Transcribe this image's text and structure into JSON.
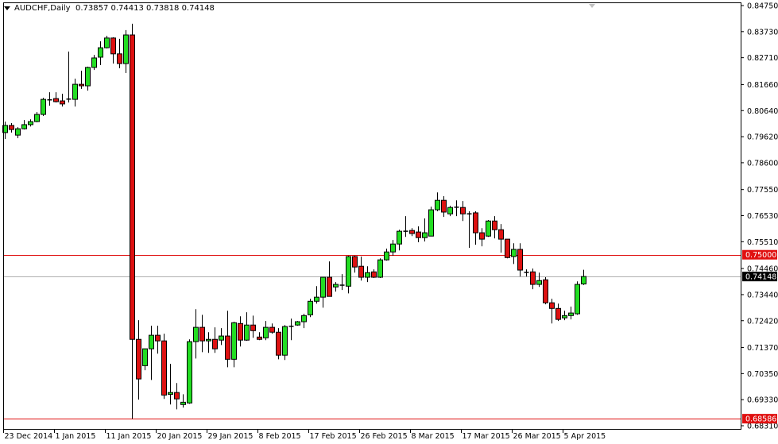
{
  "header": {
    "symbol": "AUDCHF,Daily",
    "ohlc": "0.73857 0.74413 0.73818 0.74148"
  },
  "colors": {
    "bull": "#22dd22",
    "bear": "#dd1111",
    "outline": "#000000",
    "hline": "#e01010",
    "bid_line": "#b0b0b0"
  },
  "chart_data": {
    "type": "candlestick",
    "title": "AUDCHF,Daily",
    "ylim": [
      0.6831,
      0.8475
    ],
    "y_ticks": [
      "0.84750",
      "0.83730",
      "0.82710",
      "0.81660",
      "0.80640",
      "0.79620",
      "0.78600",
      "0.77550",
      "0.76530",
      "0.75510",
      "0.74460",
      "0.73440",
      "0.72420",
      "0.71370",
      "0.70350",
      "0.69330",
      "0.68310"
    ],
    "x_ticks": [
      {
        "index": 0,
        "label": "23 Dec 2014"
      },
      {
        "index": 8,
        "label": "1 Jan 2015"
      },
      {
        "index": 16,
        "label": "11 Jan 2015"
      },
      {
        "index": 24,
        "label": "20 Jan 2015"
      },
      {
        "index": 32,
        "label": "29 Jan 2015"
      },
      {
        "index": 40,
        "label": "8 Feb 2015"
      },
      {
        "index": 48,
        "label": "17 Feb 2015"
      },
      {
        "index": 56,
        "label": "26 Feb 2015"
      },
      {
        "index": 64,
        "label": "8 Mar 2015"
      },
      {
        "index": 72,
        "label": "17 Mar 2015"
      },
      {
        "index": 80,
        "label": "26 Mar 2015"
      },
      {
        "index": 88,
        "label": "5 Apr 2015"
      }
    ],
    "horizontal_lines": [
      {
        "price": 0.75,
        "label": "0.75000",
        "kind": "level"
      },
      {
        "price": 0.68586,
        "label": "0.68586",
        "kind": "level"
      },
      {
        "price": 0.74148,
        "label": "0.74148",
        "kind": "bid"
      }
    ],
    "ohlc": [
      [
        0.7978,
        0.8021,
        0.7953,
        0.8006
      ],
      [
        0.8006,
        0.8015,
        0.7978,
        0.799
      ],
      [
        0.7968,
        0.7999,
        0.7956,
        0.7993
      ],
      [
        0.7993,
        0.8027,
        0.799,
        0.8009
      ],
      [
        0.8009,
        0.803,
        0.8002,
        0.8021
      ],
      [
        0.8021,
        0.8058,
        0.8018,
        0.8049
      ],
      [
        0.8049,
        0.8114,
        0.8043,
        0.8108
      ],
      [
        0.8105,
        0.8136,
        0.8083,
        0.8106
      ],
      [
        0.8111,
        0.8136,
        0.8096,
        0.8099
      ],
      [
        0.8102,
        0.813,
        0.808,
        0.809
      ],
      [
        0.8108,
        0.8295,
        0.8096,
        0.8109
      ],
      [
        0.8108,
        0.8189,
        0.808,
        0.8167
      ],
      [
        0.8167,
        0.822,
        0.8149,
        0.8161
      ],
      [
        0.8161,
        0.8236,
        0.8142,
        0.8233
      ],
      [
        0.8233,
        0.8282,
        0.8223,
        0.827
      ],
      [
        0.8273,
        0.8335,
        0.8242,
        0.831
      ],
      [
        0.831,
        0.8357,
        0.8307,
        0.8348
      ],
      [
        0.8348,
        0.8351,
        0.8248,
        0.8286
      ],
      [
        0.8286,
        0.8345,
        0.823,
        0.8248
      ],
      [
        0.8248,
        0.8379,
        0.8211,
        0.836
      ],
      [
        0.836,
        0.8404,
        0.6858,
        0.7169
      ],
      [
        0.7169,
        0.7244,
        0.6933,
        0.7014
      ],
      [
        0.7066,
        0.7132,
        0.7048,
        0.7132
      ],
      [
        0.7132,
        0.7222,
        0.701,
        0.7185
      ],
      [
        0.7185,
        0.7222,
        0.7113,
        0.7163
      ],
      [
        0.7163,
        0.7191,
        0.6936,
        0.6951
      ],
      [
        0.6954,
        0.7073,
        0.6914,
        0.6961
      ],
      [
        0.6961,
        0.6998,
        0.6895,
        0.6936
      ],
      [
        0.6914,
        0.6954,
        0.6902,
        0.6923
      ],
      [
        0.692,
        0.7169,
        0.6917,
        0.716
      ],
      [
        0.716,
        0.7287,
        0.7094,
        0.7216
      ],
      [
        0.7216,
        0.7265,
        0.7119,
        0.7163
      ],
      [
        0.7163,
        0.7197,
        0.7116,
        0.7169
      ],
      [
        0.7169,
        0.7216,
        0.7116,
        0.7132
      ],
      [
        0.7166,
        0.7213,
        0.7147,
        0.7182
      ],
      [
        0.7182,
        0.7281,
        0.706,
        0.7091
      ],
      [
        0.7091,
        0.7238,
        0.706,
        0.7234
      ],
      [
        0.7231,
        0.7259,
        0.7141,
        0.7166
      ],
      [
        0.7166,
        0.7275,
        0.7163,
        0.7225
      ],
      [
        0.7225,
        0.7262,
        0.7175,
        0.7203
      ],
      [
        0.7178,
        0.7197,
        0.7166,
        0.7169
      ],
      [
        0.7175,
        0.7241,
        0.7166,
        0.7216
      ],
      [
        0.7216,
        0.7231,
        0.7191,
        0.7197
      ],
      [
        0.7197,
        0.7213,
        0.7091,
        0.7107
      ],
      [
        0.7107,
        0.7225,
        0.7088,
        0.7219
      ],
      [
        0.7219,
        0.725,
        0.7166,
        0.722
      ],
      [
        0.7225,
        0.7241,
        0.7222,
        0.7238
      ],
      [
        0.7238,
        0.7269,
        0.7213,
        0.7262
      ],
      [
        0.7265,
        0.7328,
        0.7256,
        0.7318
      ],
      [
        0.7318,
        0.7377,
        0.7309,
        0.7334
      ],
      [
        0.7334,
        0.7412,
        0.7293,
        0.7412
      ],
      [
        0.7412,
        0.7474,
        0.7337,
        0.7337
      ],
      [
        0.7374,
        0.7393,
        0.7356,
        0.7384
      ],
      [
        0.7381,
        0.7424,
        0.7362,
        0.7377
      ],
      [
        0.7377,
        0.7496,
        0.7349,
        0.7493
      ],
      [
        0.7493,
        0.7496,
        0.743,
        0.7452
      ],
      [
        0.7455,
        0.7493,
        0.7399,
        0.7412
      ],
      [
        0.7412,
        0.7455,
        0.7393,
        0.743
      ],
      [
        0.7433,
        0.7443,
        0.7409,
        0.7412
      ],
      [
        0.7412,
        0.7486,
        0.7409,
        0.748
      ],
      [
        0.748,
        0.7524,
        0.7477,
        0.7511
      ],
      [
        0.7511,
        0.7558,
        0.7496,
        0.7542
      ],
      [
        0.7542,
        0.7598,
        0.7517,
        0.7592
      ],
      [
        0.7592,
        0.7651,
        0.757,
        0.7591
      ],
      [
        0.7595,
        0.7604,
        0.7573,
        0.7583
      ],
      [
        0.7589,
        0.7611,
        0.7549,
        0.7567
      ],
      [
        0.7567,
        0.7642,
        0.7552,
        0.7586
      ],
      [
        0.7573,
        0.7688,
        0.7573,
        0.7676
      ],
      [
        0.7676,
        0.7744,
        0.767,
        0.7713
      ],
      [
        0.7713,
        0.7729,
        0.7648,
        0.7667
      ],
      [
        0.766,
        0.7692,
        0.7651,
        0.7685
      ],
      [
        0.7685,
        0.7713,
        0.7651,
        0.7686
      ],
      [
        0.7685,
        0.771,
        0.7632,
        0.766
      ],
      [
        0.766,
        0.767,
        0.7527,
        0.7659
      ],
      [
        0.7664,
        0.767,
        0.7539,
        0.7586
      ],
      [
        0.7586,
        0.7604,
        0.7533,
        0.7561
      ],
      [
        0.7573,
        0.7636,
        0.757,
        0.7632
      ],
      [
        0.7632,
        0.7651,
        0.7564,
        0.7598
      ],
      [
        0.7598,
        0.762,
        0.7508,
        0.7561
      ],
      [
        0.7561,
        0.7561,
        0.7486,
        0.7489
      ],
      [
        0.7493,
        0.7545,
        0.7464,
        0.7521
      ],
      [
        0.7521,
        0.7545,
        0.7415,
        0.744
      ],
      [
        0.743,
        0.7443,
        0.7415,
        0.7431
      ],
      [
        0.7433,
        0.7446,
        0.7365,
        0.7384
      ],
      [
        0.7384,
        0.743,
        0.7374,
        0.7399
      ],
      [
        0.7402,
        0.7412,
        0.7306,
        0.7312
      ],
      [
        0.7312,
        0.7328,
        0.7231,
        0.729
      ],
      [
        0.729,
        0.7309,
        0.7241,
        0.7247
      ],
      [
        0.7253,
        0.7281,
        0.7244,
        0.7262
      ],
      [
        0.7262,
        0.7297,
        0.7247,
        0.7272
      ],
      [
        0.7269,
        0.7396,
        0.7265,
        0.7384
      ],
      [
        0.73857,
        0.74413,
        0.73818,
        0.74148
      ]
    ]
  }
}
